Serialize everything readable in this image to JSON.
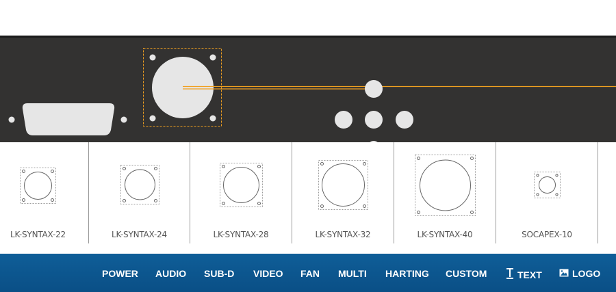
{
  "connectors": [
    {
      "label": "LK-SYNTAX-22"
    },
    {
      "label": "LK-SYNTAX-24"
    },
    {
      "label": "LK-SYNTAX-28"
    },
    {
      "label": "LK-SYNTAX-32"
    },
    {
      "label": "LK-SYNTAX-40"
    },
    {
      "label": "SOCAPEX-10"
    }
  ],
  "nav": {
    "power": "POWER",
    "audio": "AUDIO",
    "subd": "SUB-D",
    "video": "VIDEO",
    "fan": "FAN",
    "multi": "MULTI",
    "harting": "HARTING",
    "custom": "CUSTOM",
    "text": "TEXT",
    "logo": "LOGO"
  },
  "icons": {
    "text": "text-cursor-icon",
    "logo": "image-icon"
  },
  "colors": {
    "panel": "#333231",
    "cutout": "#e6e6e6",
    "guide": "#f0a020",
    "navbar": "#0f5e98",
    "label": "#555555"
  }
}
